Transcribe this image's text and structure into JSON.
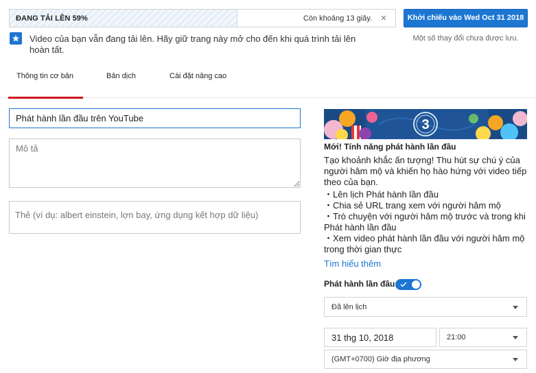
{
  "upload": {
    "status_label": "ĐANG TẢI LÊN 59%",
    "progress_percent": 59,
    "remaining_text": "Còn khoảng 13 giây.",
    "cancel_symbol": "×"
  },
  "header": {
    "premiere_button_label": "Khởi chiếu vào Wed Oct 31 2018",
    "unsaved_text": "Một số thay đổi chưa được lưu."
  },
  "notice": {
    "text": "Video của bạn vẫn đang tải lên. Hãy giữ trang này mở cho đến khi quá trình tải lên hoàn tất."
  },
  "tabs": [
    {
      "label": "Thông tin cơ bản",
      "active": true
    },
    {
      "label": "Bản dịch",
      "active": false
    },
    {
      "label": "Cài đặt nâng cao",
      "active": false
    }
  ],
  "form": {
    "title_value": "Phát hành lần đầu trên YouTube",
    "description_placeholder": "Mô tả",
    "tags_placeholder": "Thẻ (ví dụ: albert einstein, lợn bay, ứng dụng kết hợp dữ liệu)"
  },
  "promo": {
    "banner_number": "3",
    "title": "Mới! Tính năng phát hành lần đầu",
    "description": "Tạo khoảnh khắc ấn tượng! Thu hút sự chú ý của người hâm mộ và khiến họ hào hứng với video tiếp theo của bạn.",
    "bullets": [
      "・Lên lịch Phát hành lần đầu",
      "・Chia sẻ URL trang xem với người hâm mộ",
      "・Trò chuyện với người hâm mộ trước và trong khi Phát hành lần đầu",
      "・Xem video phát hành lần đầu với người hâm mộ trong thời gian thực"
    ],
    "learn_more_label": "Tìm hiểu thêm"
  },
  "premiere": {
    "toggle_label": "Phát hành lần đầu",
    "toggle_on": true,
    "schedule_select": "Đã lên lịch",
    "date_value": "31 thg 10, 2018",
    "time_select": "21:00",
    "timezone_select": "(GMT+0700) Giờ địa phương"
  },
  "colors": {
    "accent": "#1c76d2",
    "tab_indicator": "#cc181e",
    "banner_bg": "#1a4a86"
  }
}
